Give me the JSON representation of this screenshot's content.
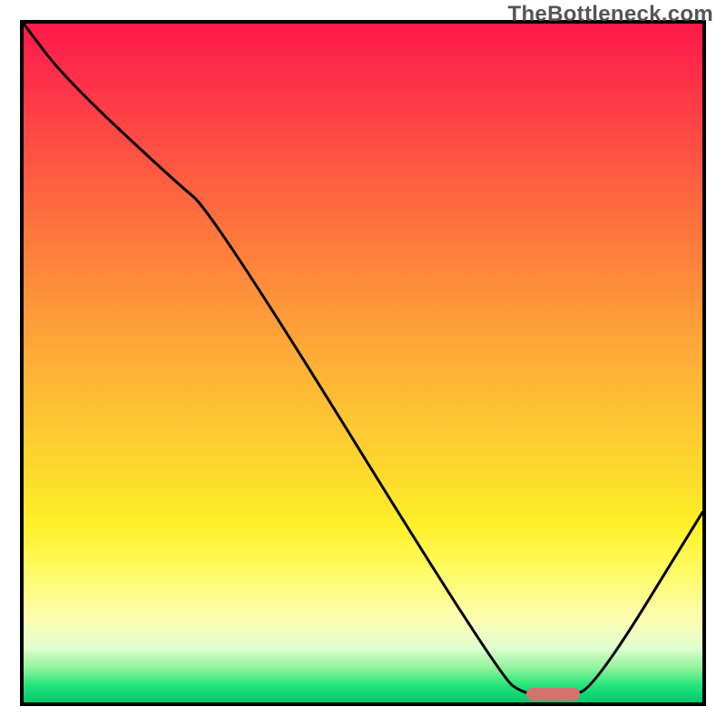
{
  "watermark": "TheBottleneck.com",
  "chart_data": {
    "type": "line",
    "title": "",
    "xlabel": "",
    "ylabel": "",
    "xlim": [
      0,
      100
    ],
    "ylim": [
      0,
      100
    ],
    "grid": false,
    "legend": false,
    "gradient_stops": [
      {
        "pos": 0,
        "color": "#fd1a4a"
      },
      {
        "pos": 6,
        "color": "#fd2a4a"
      },
      {
        "pos": 18,
        "color": "#fe4e44"
      },
      {
        "pos": 32,
        "color": "#fe7a3c"
      },
      {
        "pos": 50,
        "color": "#feaf37"
      },
      {
        "pos": 64,
        "color": "#fed42f"
      },
      {
        "pos": 74,
        "color": "#fff029"
      },
      {
        "pos": 80,
        "color": "#fffb5e"
      },
      {
        "pos": 88,
        "color": "#fcfdb4"
      },
      {
        "pos": 92,
        "color": "#e0ffcf"
      },
      {
        "pos": 95,
        "color": "#8ff29a"
      },
      {
        "pos": 97.5,
        "color": "#23e57a"
      },
      {
        "pos": 100,
        "color": "#00c869"
      }
    ],
    "series": [
      {
        "name": "curve",
        "x": [
          0,
          6,
          22,
          28,
          70,
          74,
          80,
          84,
          100
        ],
        "y": [
          100,
          92,
          77,
          72,
          4,
          1,
          1,
          2,
          28
        ]
      }
    ],
    "marker": {
      "x_start": 74,
      "x_end": 82,
      "y": 1.2,
      "color": "#d6726e"
    }
  }
}
